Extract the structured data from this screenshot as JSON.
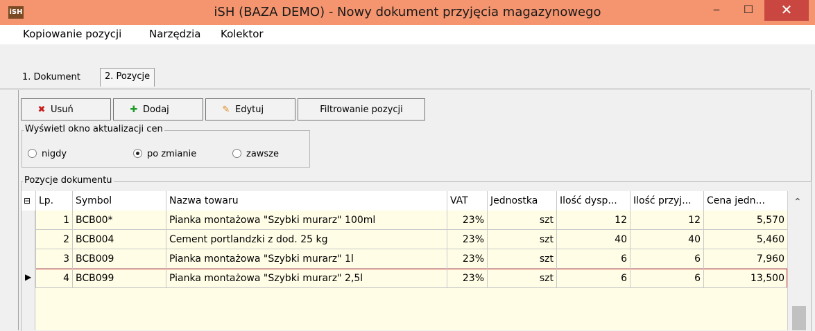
{
  "window": {
    "title": "iSH (BAZA DEMO) - Nowy dokument przyjęcia magazynowego",
    "logo_text": "iSH",
    "minimize": "‒",
    "maximize": "☐",
    "close": "✕"
  },
  "menu": [
    "Kopiowanie pozycji",
    "Narzędzia",
    "Kolektor"
  ],
  "tabs": [
    "1. Dokument",
    "2. Pozycje"
  ],
  "toolbar": {
    "delete_label": "Usuń",
    "add_label": "Dodaj",
    "edit_label": "Edytuj",
    "filter_label": "Filtrowanie pozycji"
  },
  "price_update": {
    "title": "Wyświetl okno aktualizacji cen",
    "options": [
      "nigdy",
      "po zmianie",
      "zawsze"
    ],
    "selected": "po zmianie"
  },
  "positions": {
    "title": "Pozycje dokumentu",
    "columns": [
      "Lp.",
      "Symbol",
      "Nazwa towaru",
      "VAT",
      "Jednostka",
      "Ilość dysp...",
      "Ilość przyj...",
      "Cena jedn..."
    ],
    "rows": [
      {
        "lp": "1",
        "symbol": "BCB00*",
        "name": "Pianka montażowa \"Szybki murarz\" 100ml",
        "vat": "23%",
        "unit": "szt",
        "qty_disp": "12",
        "qty_recv": "12",
        "price": "5,570"
      },
      {
        "lp": "2",
        "symbol": "BCB004",
        "name": "Cement portlandzki z dod. 25 kg",
        "vat": "23%",
        "unit": "szt",
        "qty_disp": "40",
        "qty_recv": "40",
        "price": "5,460"
      },
      {
        "lp": "3",
        "symbol": "BCB009",
        "name": "Pianka montażowa \"Szybki murarz\" 1l",
        "vat": "23%",
        "unit": "szt",
        "qty_disp": "6",
        "qty_recv": "6",
        "price": "7,960"
      },
      {
        "lp": "4",
        "symbol": "BCB099",
        "name": "Pianka montażowa \"Szybki murarz\" 2,5l",
        "vat": "23%",
        "unit": "szt",
        "qty_disp": "6",
        "qty_recv": "6",
        "price": "13,500"
      }
    ],
    "active_row": "4"
  },
  "colors": {
    "titlebar": "#f5956f",
    "close_button": "#c94740",
    "grid_background": "#fffde6",
    "active_row_border": "#d83b3b"
  }
}
